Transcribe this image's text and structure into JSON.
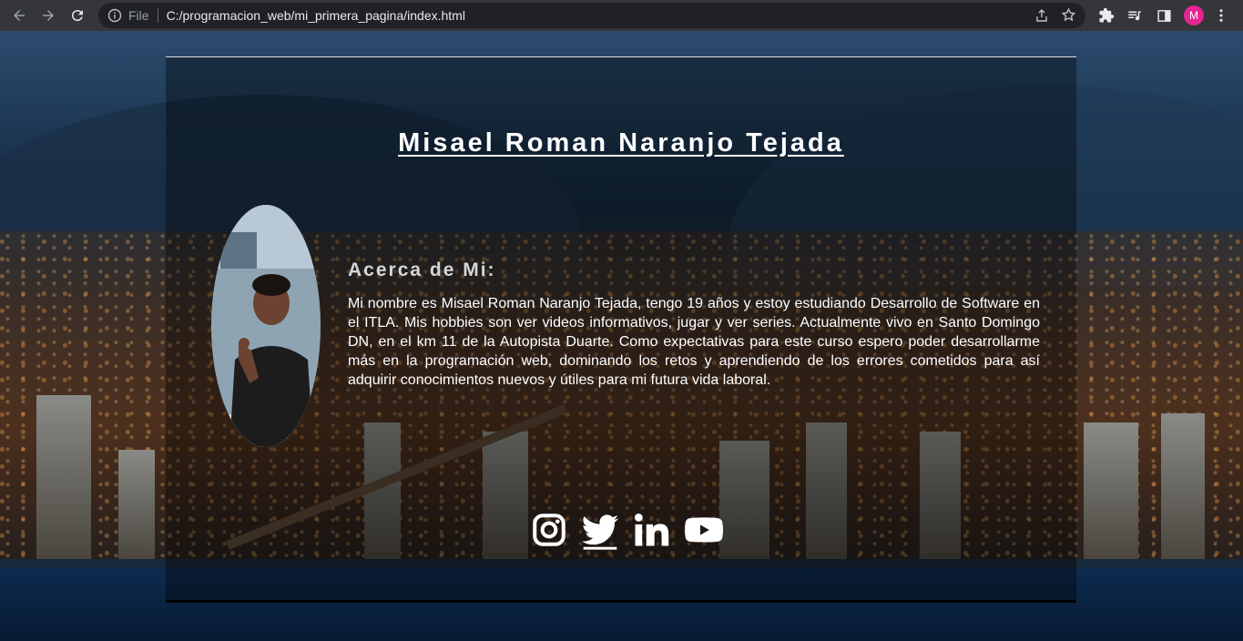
{
  "browser": {
    "scheme_label": "File",
    "url": "C:/programacion_web/mi_primera_pagina/index.html",
    "profile_initial": "M",
    "profile_color": "#e52592"
  },
  "page": {
    "name": "Misael Roman Naranjo Tejada",
    "about_title": "Acerca de Mi:",
    "about_text": "Mi nombre es Misael Roman Naranjo Tejada, tengo 19 años y estoy estudiando Desarrollo de Software en el ITLA. Mis hobbies son ver videos informativos, jugar y ver series. Actualmente vivo en Santo Domingo DN, en el km 11 de la Autopista Duarte. Como expectativas para este curso espero poder desarrollarme más en la programación web, dominando los retos y aprendiendo de los errores cometidos para así adquirir conocimientos nuevos y útiles para mi futura vida laboral.",
    "social_icons": [
      "instagram-icon",
      "twitter-icon",
      "linkedin-icon",
      "youtube-icon"
    ]
  }
}
